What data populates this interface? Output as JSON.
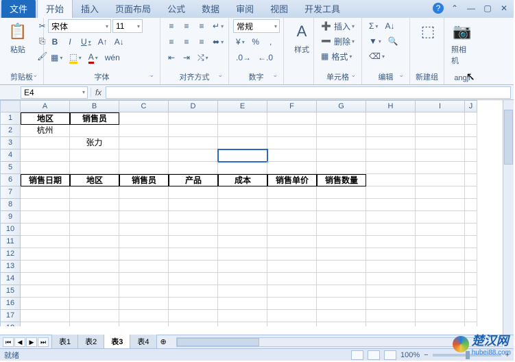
{
  "tabs": {
    "file": "文件",
    "items": [
      "开始",
      "插入",
      "页面布局",
      "公式",
      "数据",
      "审阅",
      "视图",
      "开发工具"
    ],
    "activeIndex": 0
  },
  "ribbon": {
    "clipboard": {
      "label": "剪贴板",
      "paste": "粘贴"
    },
    "font": {
      "label": "字体",
      "name": "宋体",
      "size": "11",
      "bold": "B",
      "italic": "I",
      "underline": "U"
    },
    "align": {
      "label": "对齐方式",
      "general": "常规"
    },
    "number": {
      "label": "数字"
    },
    "styles": {
      "label": "样式",
      "btn": "样式"
    },
    "cells": {
      "label": "单元格",
      "insert": "插入",
      "delete": "删除",
      "format": "格式"
    },
    "edit": {
      "label": "编辑"
    },
    "newgroup": {
      "label": "新建组",
      "camera": "照相机"
    },
    "hover": "angji"
  },
  "namebox": "E4",
  "fx": "fx",
  "columns": [
    "A",
    "B",
    "C",
    "D",
    "E",
    "F",
    "G",
    "H",
    "I",
    "J"
  ],
  "rowCount": 18,
  "cells": {
    "r1": {
      "A": "地区",
      "B": "销售员"
    },
    "r2": {
      "A": "杭州"
    },
    "r3": {
      "B": "张力"
    },
    "r6": {
      "A": "销售日期",
      "B": "地区",
      "C": "销售员",
      "D": "产品",
      "E": "成本",
      "F": "销售单价",
      "G": "销售数量"
    }
  },
  "sheets": [
    "表1",
    "表2",
    "表3",
    "表4"
  ],
  "activeSheet": 2,
  "status": {
    "ready": "就绪",
    "zoom": "100%"
  },
  "watermark": {
    "text": "楚汉网",
    "sub": "hubei88.com"
  }
}
